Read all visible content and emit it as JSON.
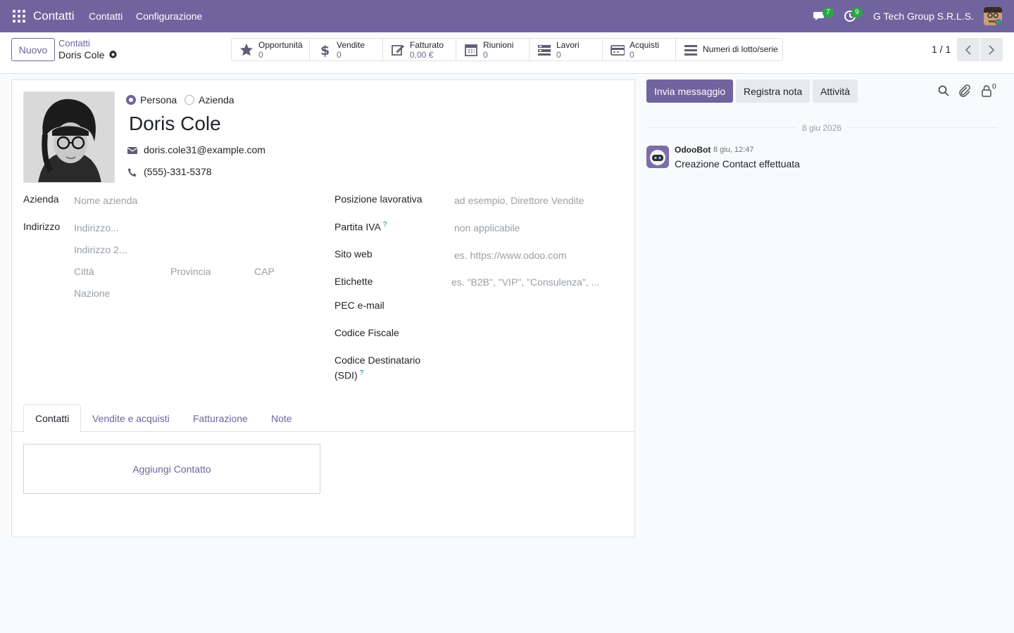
{
  "navbar": {
    "app_name": "Contatti",
    "menu": [
      "Contatti",
      "Configurazione"
    ],
    "messages_badge": "7",
    "activities_badge": "9",
    "company": "G Tech Group S.R.L.S."
  },
  "control_panel": {
    "new_button": "Nuovo",
    "breadcrumb_parent": "Contatti",
    "breadcrumb_current": "Doris Cole",
    "smart_buttons": [
      {
        "label": "Opportunità",
        "value": "0",
        "icon": "star-icon"
      },
      {
        "label": "Vendite",
        "value": "0",
        "icon": "dollar-icon"
      },
      {
        "label": "Fatturato",
        "value": "0,00 €",
        "icon": "edit-invoice-icon"
      },
      {
        "label": "Riunioni",
        "value": "0",
        "icon": "calendar-icon"
      },
      {
        "label": "Lavori",
        "value": "0",
        "icon": "tasks-icon"
      },
      {
        "label": "Acquisti",
        "value": "0",
        "icon": "credit-card-icon"
      },
      {
        "label": "Numeri di lotto/serie",
        "value": "",
        "icon": "bars-icon"
      }
    ],
    "pager": "1 / 1"
  },
  "form": {
    "type_options": [
      "Persona",
      "Azienda"
    ],
    "type_selected": "Persona",
    "name": "Doris Cole",
    "email": "doris.cole31@example.com",
    "phone": "(555)-331-5378",
    "left_fields": {
      "company_label": "Azienda",
      "company_placeholder": "Nome azienda",
      "address_label": "Indirizzo",
      "street_placeholder": "Indirizzo...",
      "street2_placeholder": "Indirizzo 2...",
      "city_placeholder": "Città",
      "state_placeholder": "Provincia",
      "zip_placeholder": "CAP",
      "country_placeholder": "Nazione"
    },
    "right_fields": {
      "job_label": "Posizione lavorativa",
      "job_placeholder": "ad esempio, Direttore Vendite",
      "vat_label": "Partita IVA",
      "vat_placeholder": "non applicabile",
      "website_label": "Sito web",
      "website_placeholder": "es. https://www.odoo.com",
      "tags_label": "Etichette",
      "tags_placeholder": "es. \"B2B\", \"VIP\", \"Consulenza\", ...",
      "pec_label": "PEC e-mail",
      "fiscal_label": "Codice Fiscale",
      "sdi_label_1": "Codice Destinatario",
      "sdi_label_2": "(SDI)",
      "help_mark": "?"
    },
    "tabs": [
      "Contatti",
      "Vendite e acquisti",
      "Fatturazione",
      "Note"
    ],
    "active_tab": "Contatti",
    "add_contact": "Aggiungi Contatto"
  },
  "chatter": {
    "send_message": "Invia messaggio",
    "log_note": "Registra nota",
    "activities": "Attività",
    "followers_count": "0",
    "date_separator": "8 giu 2026",
    "message": {
      "author": "OdooBot",
      "date": "8 giu, 12:47",
      "body": "Creazione Contact effettuata"
    }
  },
  "colors": {
    "brand": "#71639e",
    "badge": "#28a745",
    "help": "#017e84"
  }
}
